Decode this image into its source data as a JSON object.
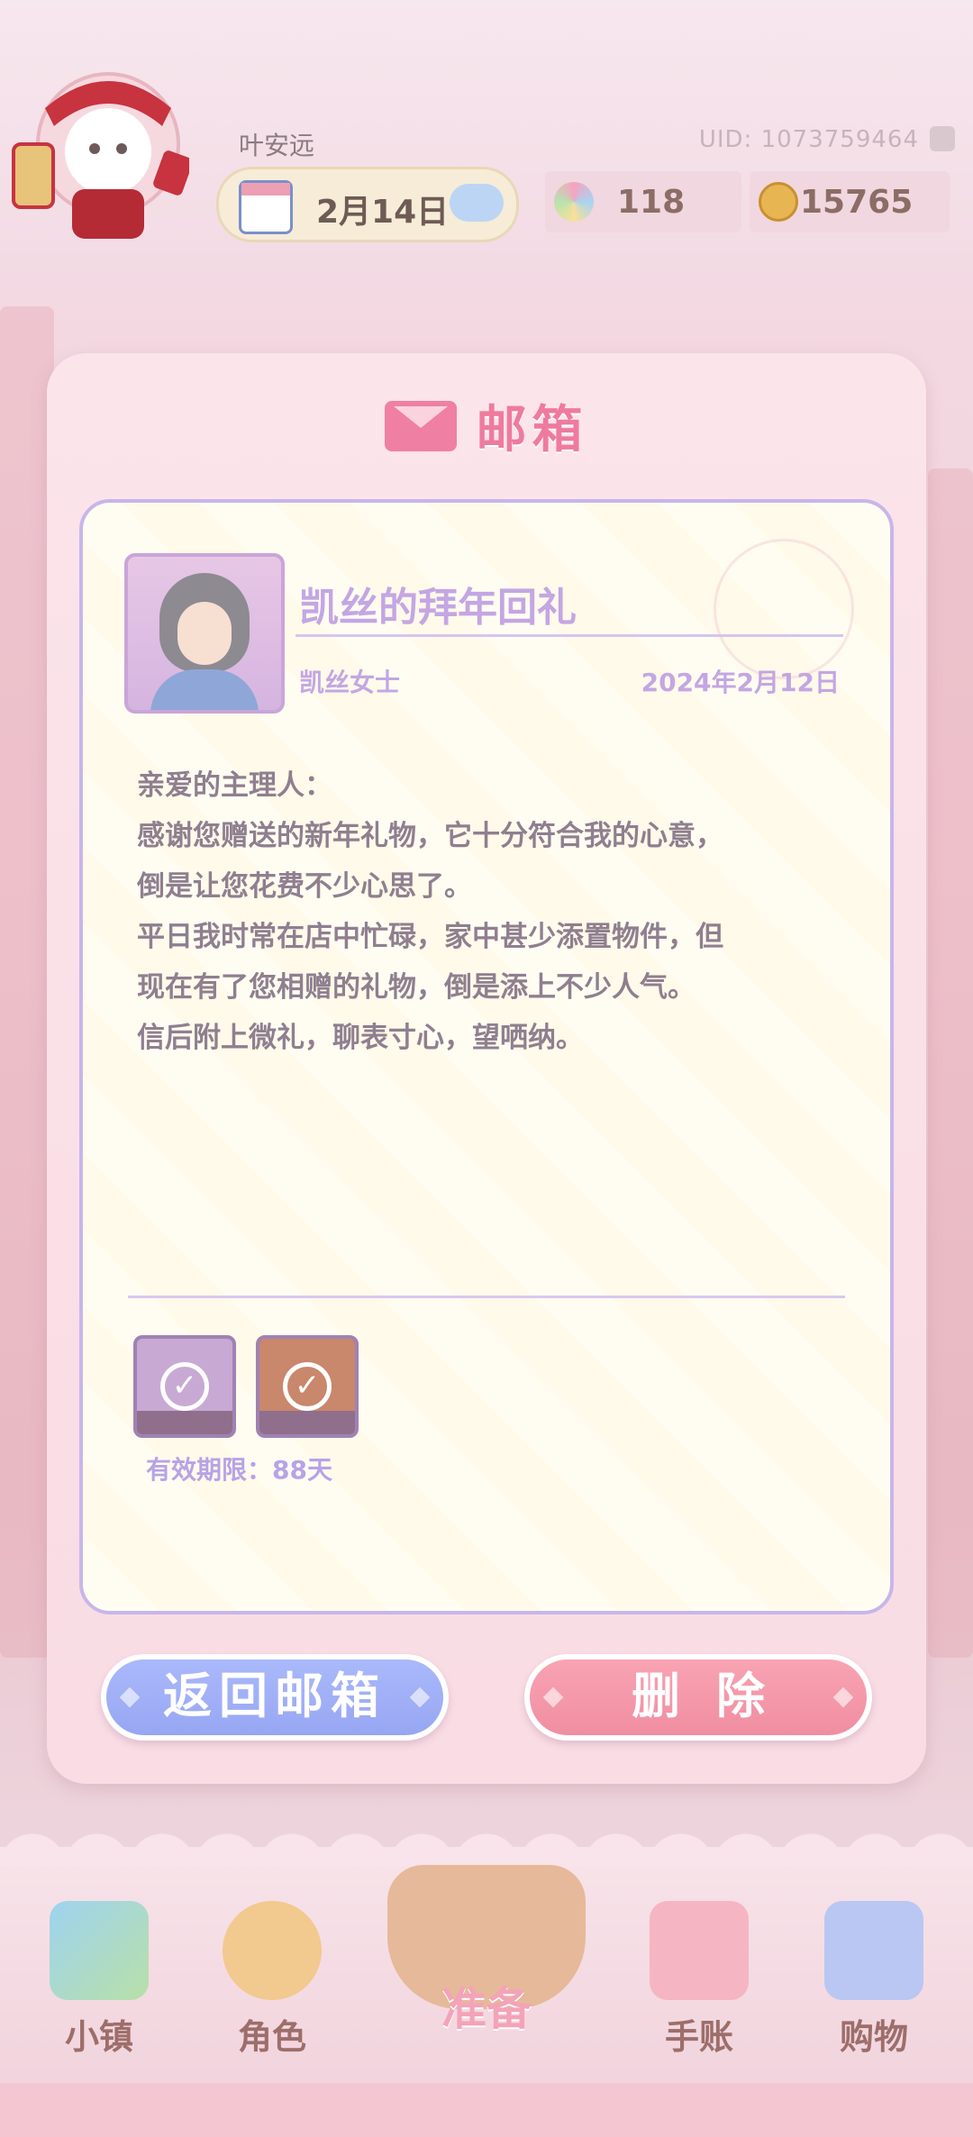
{
  "header": {
    "username": "叶安远",
    "uid": "UID: 1073759464",
    "date": "2月14日",
    "flower_count": "118",
    "coin_count": "15765"
  },
  "modal": {
    "title": "邮箱"
  },
  "letter": {
    "subject": "凯丝的拜年回礼",
    "sender": "凯丝女士",
    "date": "2024年2月12日",
    "body_lines": [
      "亲爱的主理人：",
      "感谢您赠送的新年礼物，它十分符合我的心意，",
      "倒是让您花费不少心思了。",
      "平日我时常在店中忙碌，家中甚少添置物件，但",
      "现在有了您相赠的礼物，倒是添上不少人气。",
      "信后附上微礼，聊表寸心，望哂纳。"
    ],
    "rewards": [
      {
        "icon": "collected-item-icon",
        "status": "claimed"
      },
      {
        "icon": "collected-item-icon",
        "status": "claimed"
      }
    ],
    "expiry": "有效期限：88天"
  },
  "actions": {
    "back_label": "返回邮箱",
    "delete_label": "删除"
  },
  "nav": {
    "town": "小镇",
    "character": "角色",
    "prepare": "准备",
    "journal": "手账",
    "shop": "购物"
  },
  "colors": {
    "accent_pink": "#ee7b9d",
    "lavender": "#c4a6e3",
    "button_blue": "#97a6f2",
    "button_pink": "#f08ea1"
  }
}
